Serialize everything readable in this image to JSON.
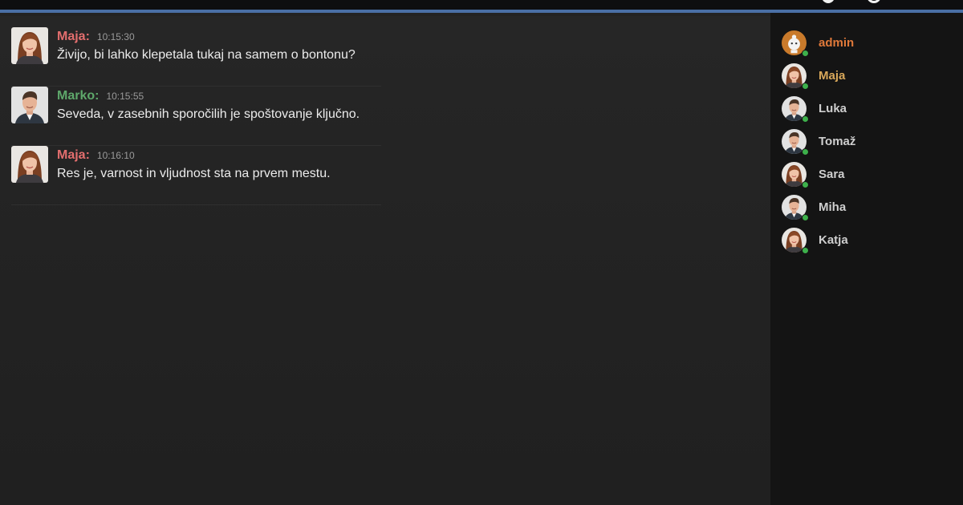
{
  "colors": {
    "topbar_accent": "#4a6fa5",
    "maja": "#e36e6e",
    "marko": "#5ea86b",
    "admin": "#e0793a",
    "current_user": "#d9a85a",
    "online": "#3db04b"
  },
  "topbar": {
    "icons": [
      "shield-icon",
      "user-icon",
      "grid-icon"
    ]
  },
  "messages": [
    {
      "author": "Maja:",
      "time": "10:15:30",
      "text": "Živijo, bi lahko klepetala tukaj na samem o bontonu?"
    },
    {
      "author": "Marko:",
      "time": "10:15:55",
      "text": "Seveda, v zasebnih sporočilih je spoštovanje ključno."
    },
    {
      "author": "Maja:",
      "time": "10:16:10",
      "text": "Res je, varnost in vljudnost sta na prvem mestu."
    }
  ],
  "users": [
    {
      "name": "admin"
    },
    {
      "name": "Maja"
    },
    {
      "name": "Luka"
    },
    {
      "name": "Tomaž"
    },
    {
      "name": "Sara"
    },
    {
      "name": "Miha"
    },
    {
      "name": "Katja"
    }
  ]
}
